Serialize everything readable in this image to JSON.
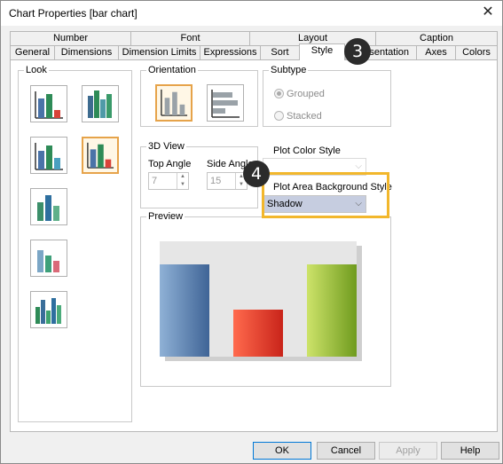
{
  "window": {
    "title": "Chart Properties [bar chart]",
    "close_glyph": "✕"
  },
  "tabs_row1": [
    "Number",
    "Font",
    "Layout",
    "Caption"
  ],
  "tabs_row2": [
    "General",
    "Dimensions",
    "Dimension Limits",
    "Expressions",
    "Sort",
    "Style",
    "Presentation",
    "Axes",
    "Colors"
  ],
  "active_tab": "Style",
  "look": {
    "label": "Look",
    "selected_index": 3
  },
  "orientation": {
    "label": "Orientation",
    "selected": "vertical"
  },
  "subtype": {
    "label": "Subtype",
    "options": [
      "Grouped",
      "Stacked"
    ],
    "selected": "Grouped"
  },
  "view3d": {
    "label": "3D View",
    "top_angle_label": "Top Angle",
    "top_angle_value": "7",
    "side_angle_label": "Side Angle",
    "side_angle_value": "15"
  },
  "plot_color_style": {
    "label": "Plot Color Style",
    "value": ""
  },
  "plot_area_bg": {
    "label": "Plot Area Background Style",
    "value": "Shadow"
  },
  "preview": {
    "label": "Preview"
  },
  "buttons": {
    "ok": "OK",
    "cancel": "Cancel",
    "apply": "Apply",
    "help": "Help"
  },
  "callouts": {
    "step3": "3",
    "step4": "4"
  },
  "colors": {
    "highlight": "#f2b72c",
    "badge": "#2b2b2b",
    "bar_blue": "#4a73a8",
    "bar_red": "#e8402a",
    "bar_green": "#8fbb2d"
  }
}
